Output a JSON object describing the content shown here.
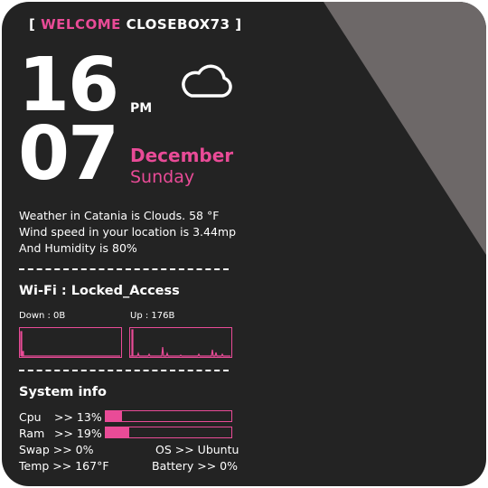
{
  "header": {
    "bracket_open": "[",
    "welcome_word": "WELCOME",
    "user_name": "CLOSEBOX73",
    "bracket_close": "]"
  },
  "clock": {
    "hour": "16",
    "minute": "07",
    "ampm": "PM",
    "month": "December",
    "weekday": "Sunday",
    "weather_icon": "cloud-icon"
  },
  "weather": {
    "line1": "Weather in Catania is Clouds. 58 °F",
    "line2": "Wind speed in your location is 3.44mp",
    "line3": "And Humidity is 80%"
  },
  "network": {
    "title": "Wi-Fi : Locked_Access",
    "down_label": "Down : 0B",
    "up_label": "Up : 176B"
  },
  "system": {
    "title": "System info",
    "cpu_label": "Cpu",
    "cpu_value": ">> 13%",
    "cpu_fraction": 0.13,
    "ram_label": "Ram",
    "ram_value": ">> 19%",
    "ram_fraction": 0.19,
    "swap_text": "Swap >> 0%",
    "os_text": "OS >> Ubuntu",
    "temp_text": "Temp >> 167°F",
    "battery_text": "Battery >> 0%"
  },
  "colors": {
    "accent": "#e94b97",
    "background": "#232323",
    "fold": "#6d6868"
  }
}
